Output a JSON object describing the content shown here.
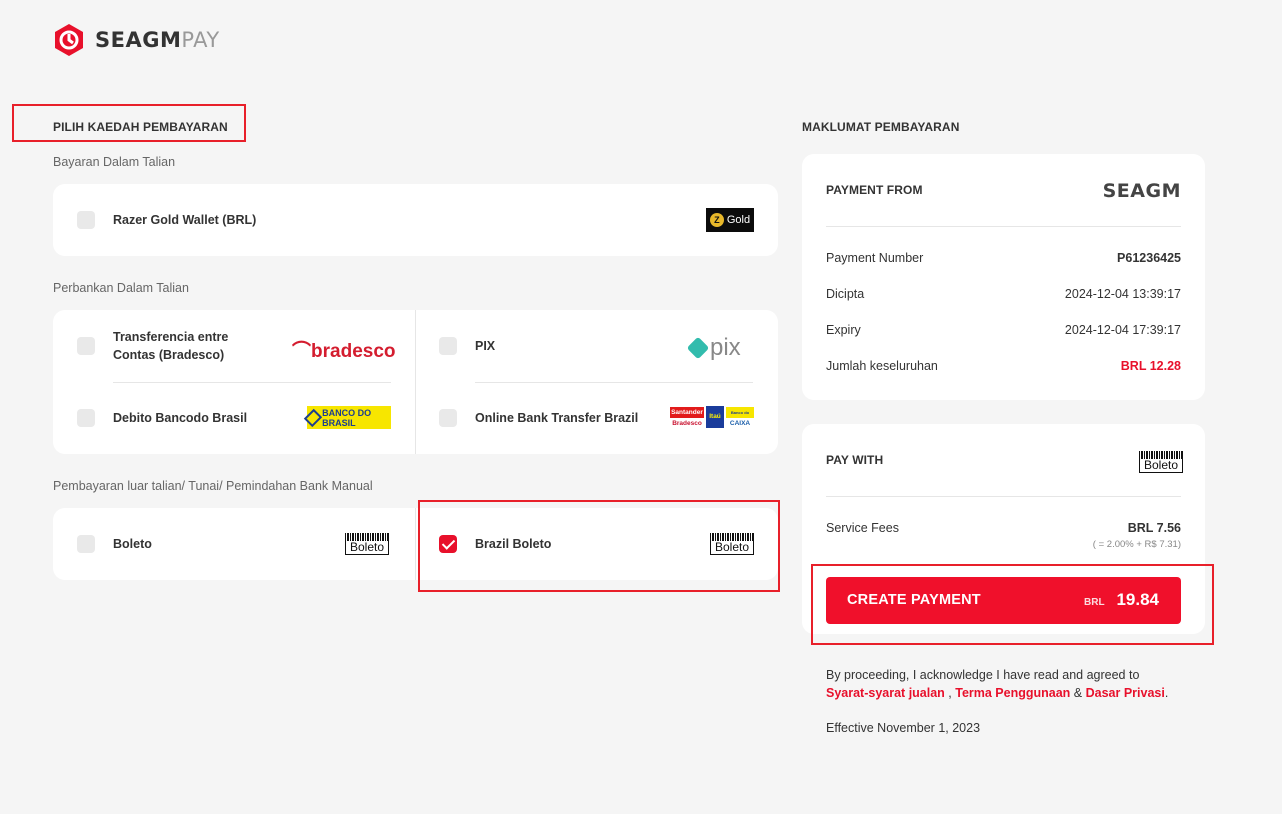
{
  "brand": {
    "name_main": "SEAGM",
    "name_sub": "PAY",
    "header_logo": "SEAGM"
  },
  "colors": {
    "accent": "#f0102b",
    "annotation": "#e8202a"
  },
  "left": {
    "title": "PILIH KAEDAH PEMBAYARAN",
    "sections": [
      {
        "label": "Bayaran Dalam Talian",
        "options": [
          {
            "label": "Razer Gold Wallet (BRL)",
            "checked": false,
            "logo": "Gold"
          }
        ]
      },
      {
        "label": "Perbankan Dalam Talian",
        "options": [
          {
            "label": "Transferencia entre Contas (Bradesco)",
            "checked": false,
            "logo": "bradesco"
          },
          {
            "label": "PIX",
            "checked": false,
            "logo": "pix"
          },
          {
            "label": "Debito Bancodo Brasil",
            "checked": false,
            "logo": "BANCO DO BRASIL"
          },
          {
            "label": "Online Bank Transfer Brazil",
            "checked": false,
            "logo": "banks-icon",
            "logo_texts": {
              "santander": "Santander",
              "itau": "Itaú",
              "bradesco": "Bradesco",
              "bb": "Banco do Brasil",
              "caixa": "CAIXA"
            }
          }
        ]
      },
      {
        "label": "Pembayaran luar talian/ Tunai/ Pemindahan Bank Manual",
        "options": [
          {
            "label": "Boleto",
            "checked": false,
            "logo": "Boleto"
          },
          {
            "label": "Brazil Boleto",
            "checked": true,
            "logo": "Boleto"
          }
        ]
      }
    ]
  },
  "right": {
    "title": "MAKLUMAT PEMBAYARAN",
    "payment_from": {
      "title": "PAYMENT FROM",
      "rows": [
        {
          "label": "Payment Number",
          "value": "P61236425"
        },
        {
          "label": "Dicipta",
          "value": "2024-12-04 13:39:17"
        },
        {
          "label": "Expiry",
          "value": "2024-12-04 17:39:17"
        },
        {
          "label": "Jumlah keseluruhan",
          "value": "BRL 12.28"
        }
      ]
    },
    "pay_with": {
      "title": "PAY WITH",
      "logo": "Boleto",
      "service_fees_label": "Service Fees",
      "service_fees_value": "BRL 7.56",
      "service_fees_note": "( = 2.00% + R$ 7.31)"
    },
    "create_button": {
      "label": "CREATE PAYMENT",
      "currency": "BRL",
      "amount": "19.84"
    },
    "legal": {
      "text_before": "By proceeding, I acknowledge I have read and agreed to",
      "link_terms_sale": "Syarat-syarat jualan",
      "sep1": " , ",
      "link_terms_use": "Terma Penggunaan",
      "sep2": " & ",
      "link_privacy": "Dasar Privasi",
      "end": ".",
      "effective": "Effective November 1, 2023"
    }
  }
}
